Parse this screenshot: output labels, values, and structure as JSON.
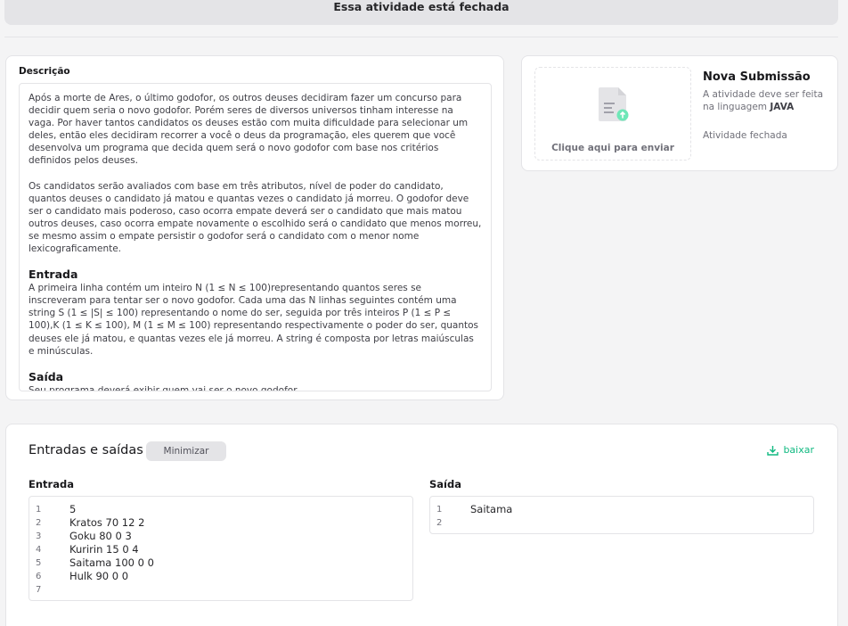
{
  "banner": {
    "text": "Essa atividade está fechada"
  },
  "description": {
    "title": "Descrição",
    "paragraphs": [
      "Após a morte de Ares, o último godofor, os outros deuses decidiram fazer um concurso para decidir quem seria o novo godofor. Porém seres de diversos universos tinham interesse na vaga. Por haver tantos candidatos os deuses estão com muita dificuldade para selecionar um deles, então eles decidiram recorrer a você o deus da programação, eles querem que você desenvolva um programa que decida quem será o novo godofor com base nos critérios definidos pelos deuses.",
      "Os candidatos serão avaliados com base em três atributos, nível de poder do candidato, quantos deuses o candidato já matou e quantas vezes o candidato já morreu. O godofor deve ser o candidato mais poderoso, caso ocorra empate deverá ser o candidato que mais matou outros deuses, caso ocorra empate novamente o escolhido será o candidato que menos morreu, se mesmo assim o empate persistir o godofor será o candidato com o menor nome lexicograficamente."
    ],
    "input_heading": "Entrada",
    "input_text": "A primeira linha contém um inteiro N (1 ≤ N ≤ 100)representando quantos seres se inscreveram para tentar ser o novo godofor. Cada uma das N linhas seguintes contém uma string S (1 ≤ |S| ≤ 100) representando o nome do ser, seguida por três inteiros P (1 ≤ P ≤ 100),K (1 ≤ K ≤ 100), M (1 ≤ M ≤ 100) representando respectivamente o poder do ser, quantos deuses ele já matou, e quantas vezes ele já morreu. A string é composta por letras maiúsculas e minúsculas.",
    "output_heading": "Saída",
    "output_text": "Seu programa deverá exibir quem vai ser o novo godofor."
  },
  "submission": {
    "upload_label": "Clique aqui para enviar",
    "title": "Nova Submissão",
    "language_prefix": "A atividade deve ser feita na linguagem ",
    "language": "JAVA",
    "status": "Atividade fechada"
  },
  "io": {
    "title": "Entradas e saídas",
    "minimize_label": "Minimizar",
    "download_label": "baixar",
    "input_label": "Entrada",
    "output_label": "Saída",
    "input_lines": [
      "5",
      "Kratos 70 12 2",
      "Goku 80 0 3",
      "Kuririn 15 0 4",
      "Saitama 100 0 0",
      "Hulk 90 0 0",
      ""
    ],
    "output_lines": [
      "Saitama",
      ""
    ]
  }
}
